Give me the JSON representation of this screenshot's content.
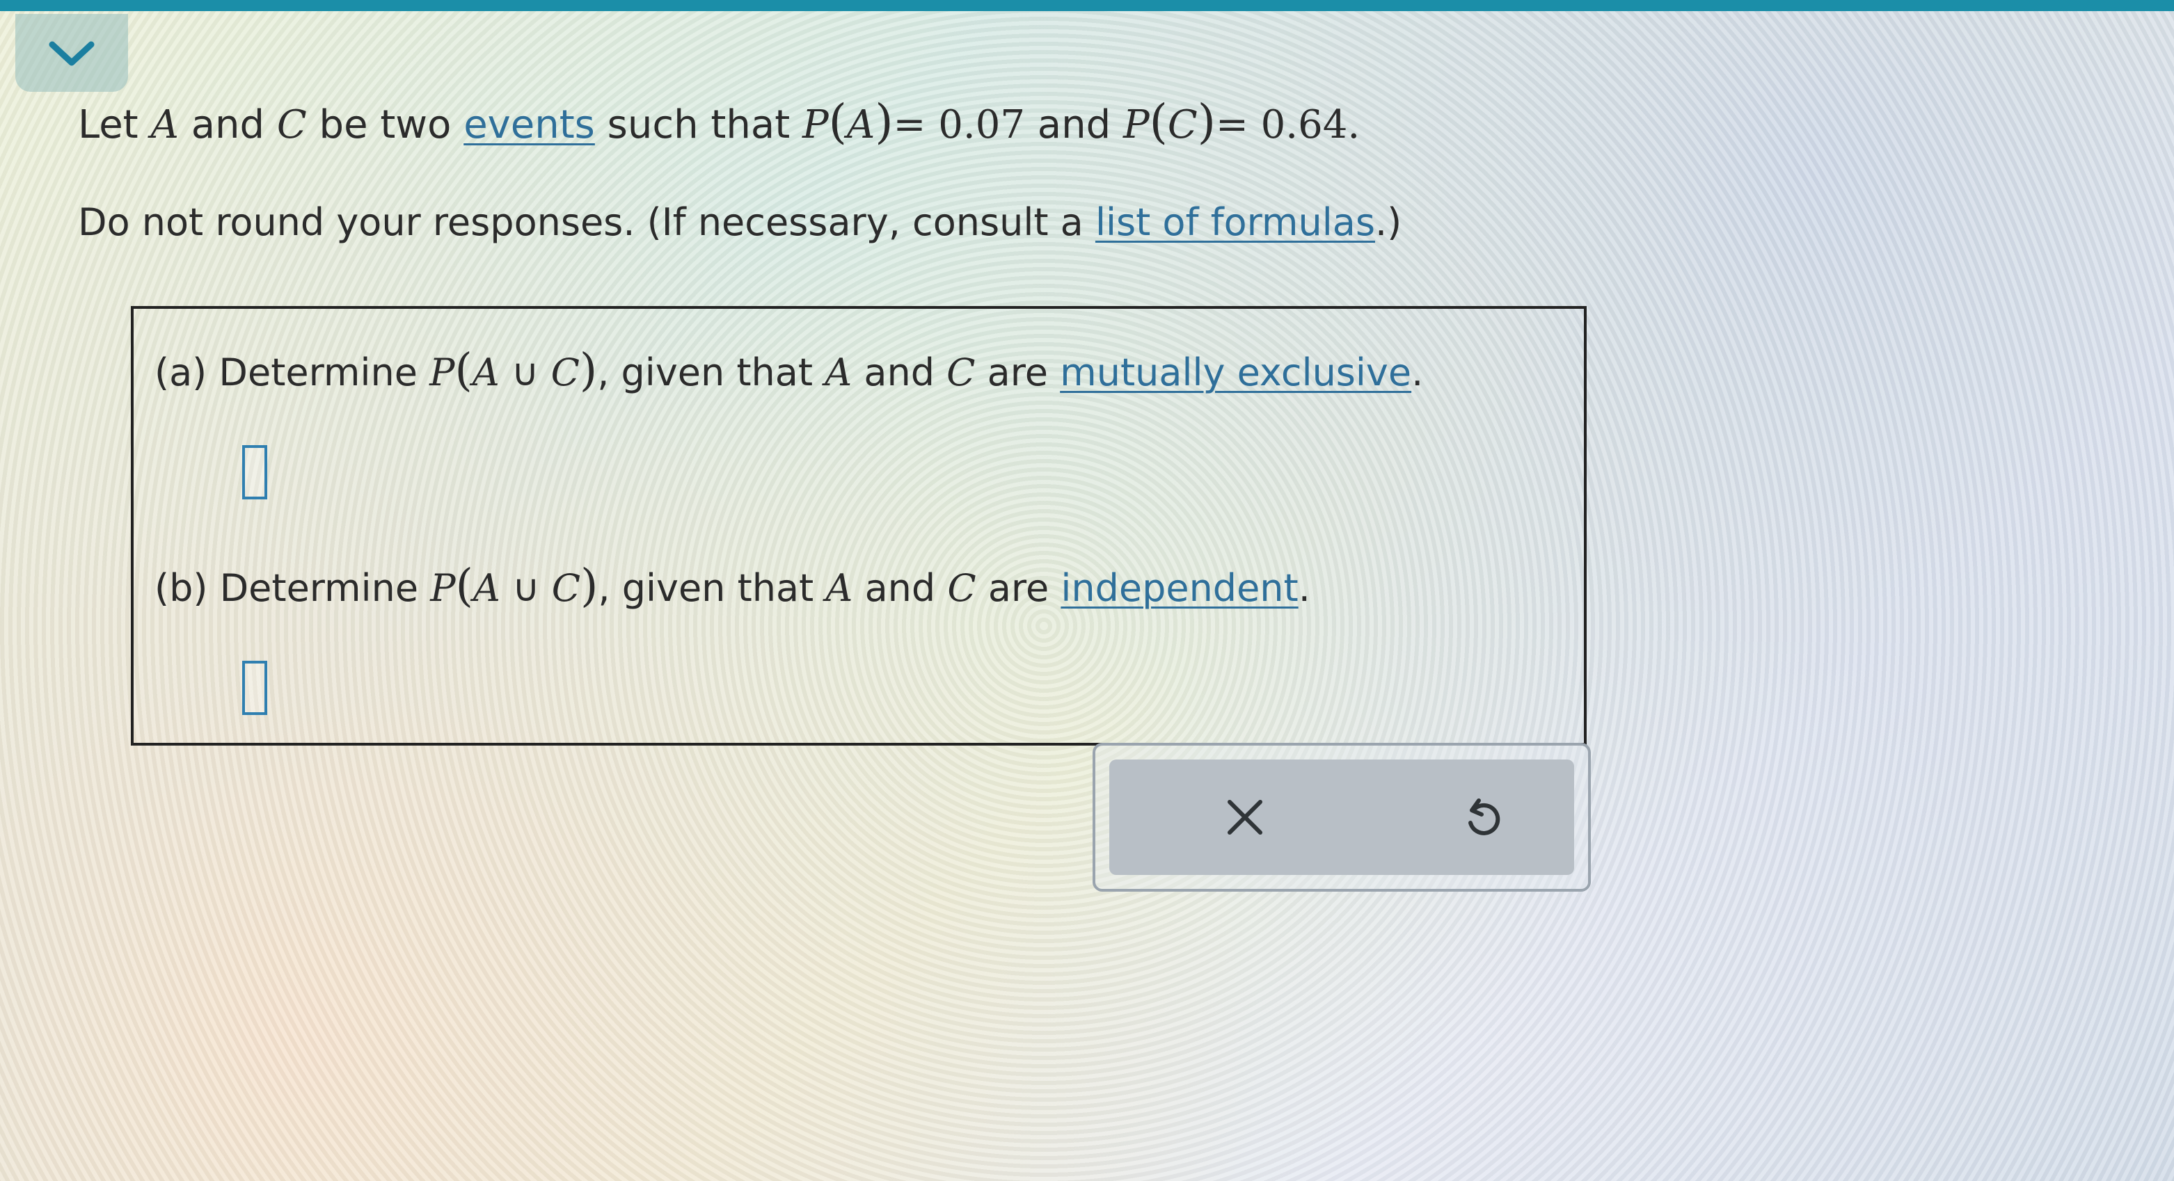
{
  "problem": {
    "intro": {
      "let": "Let",
      "var_a": "A",
      "and1": "and",
      "var_c": "C",
      "be_two": "be two",
      "events_link": "events",
      "such_that": "such that",
      "p1": "P",
      "p1_var": "A",
      "eq1": "= 0.07",
      "and2": "and",
      "p2": "P",
      "p2_var": "C",
      "eq2": "= 0.64."
    },
    "instruction": {
      "text": "Do not round your responses. (If necessary, consult a",
      "formulas_link": "list of formulas",
      "suffix": ".)"
    }
  },
  "parts": {
    "a": {
      "label": "(a)",
      "determine": "Determine",
      "p": "P",
      "union_a": "A",
      "union_symbol": "∪",
      "union_c": "C",
      "given_that": ", given that",
      "var_a": "A",
      "and": "and",
      "var_c": "C",
      "are": "are",
      "condition_link": "mutually exclusive",
      "period": ".",
      "answer_value": ""
    },
    "b": {
      "label": "(b)",
      "determine": "Determine",
      "p": "P",
      "union_a": "A",
      "union_symbol": "∪",
      "union_c": "C",
      "given_that": ", given that",
      "var_a": "A",
      "and": "and",
      "var_c": "C",
      "are": "are",
      "condition_link": "independent",
      "period": ".",
      "answer_value": ""
    }
  },
  "actions": {
    "clear_icon": "close-icon",
    "undo_icon": "undo-icon"
  },
  "colors": {
    "top_bar": "#1b8ea8",
    "link": "#2f6f9a",
    "input_border": "#2f7fb0",
    "action_panel": "#b8bfc6"
  }
}
